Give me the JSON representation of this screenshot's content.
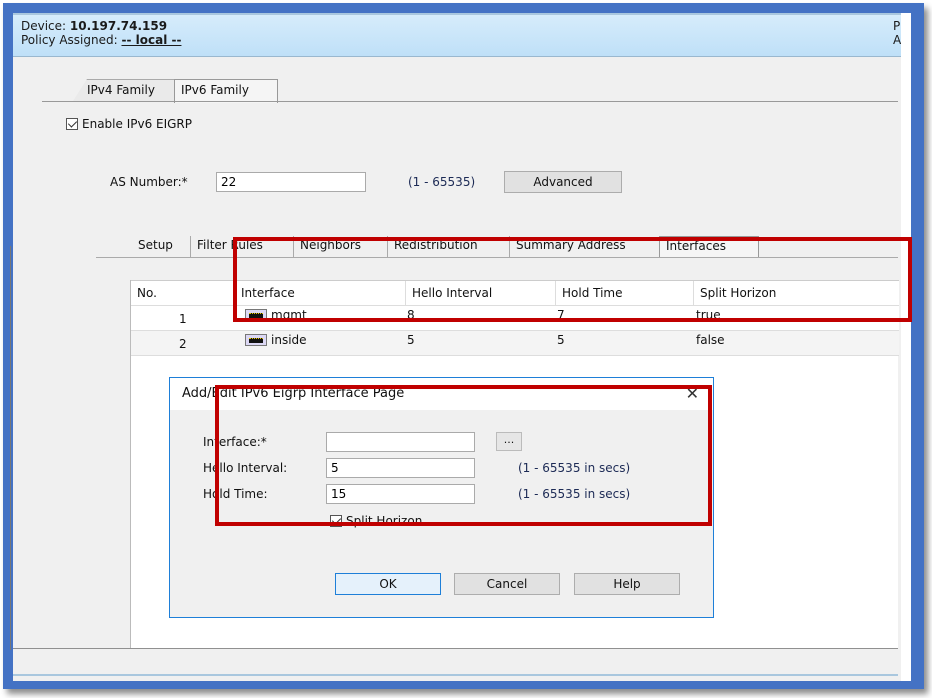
{
  "header": {
    "device_label": "Device:",
    "device_value": "10.197.74.159",
    "policy_label": "Policy Assigned:",
    "policy_value": "-- local --",
    "right_line1": "P",
    "right_line2": "A"
  },
  "family_tabs": [
    {
      "label": "IPv4 Family",
      "active": false
    },
    {
      "label": "IPv6 Family",
      "active": true
    }
  ],
  "enable_eigrp": {
    "label": "Enable IPv6 EIGRP",
    "checked": true
  },
  "as_number": {
    "label": "AS Number:*",
    "value": "22",
    "range": "(1 - 65535)",
    "advanced_label": "Advanced"
  },
  "sub_tabs": [
    {
      "label": "Setup",
      "active": false
    },
    {
      "label": "Filter Rules",
      "active": false
    },
    {
      "label": "Neighbors",
      "active": false
    },
    {
      "label": "Redistribution",
      "active": false
    },
    {
      "label": "Summary Address",
      "active": false
    },
    {
      "label": "Interfaces",
      "active": true
    }
  ],
  "table": {
    "columns": [
      "No.",
      "Interface",
      "Hello Interval",
      "Hold Time",
      "Split Horizon"
    ],
    "rows": [
      {
        "no": "1",
        "interface": "mgmt",
        "interface_icon": "network-port-icon",
        "hello": "8",
        "hold": "7",
        "split": "true"
      },
      {
        "no": "2",
        "interface": "inside",
        "interface_icon": "network-port-icon",
        "hello": "5",
        "hold": "5",
        "split": "false"
      }
    ]
  },
  "dialog": {
    "title": "Add/Edit IPv6 Eigrp Interface Page",
    "close_icon": "close-icon",
    "interface_label": "Interface:*",
    "interface_value": "",
    "browse_label": "...",
    "hello_label": "Hello Interval:",
    "hello_value": "5",
    "hello_range": "(1 - 65535 in secs)",
    "hold_label": "Hold Time:",
    "hold_value": "15",
    "hold_range": "(1 - 65535 in secs)",
    "split_horizon_label": "Split Horizon",
    "split_horizon_checked": true,
    "ok_label": "OK",
    "cancel_label": "Cancel",
    "help_label": "Help"
  },
  "colors": {
    "frame_border": "#4472c4",
    "highlight_box": "#c00000",
    "dialog_border": "#1e7fd8",
    "header_bg": "#c7e5fa"
  }
}
